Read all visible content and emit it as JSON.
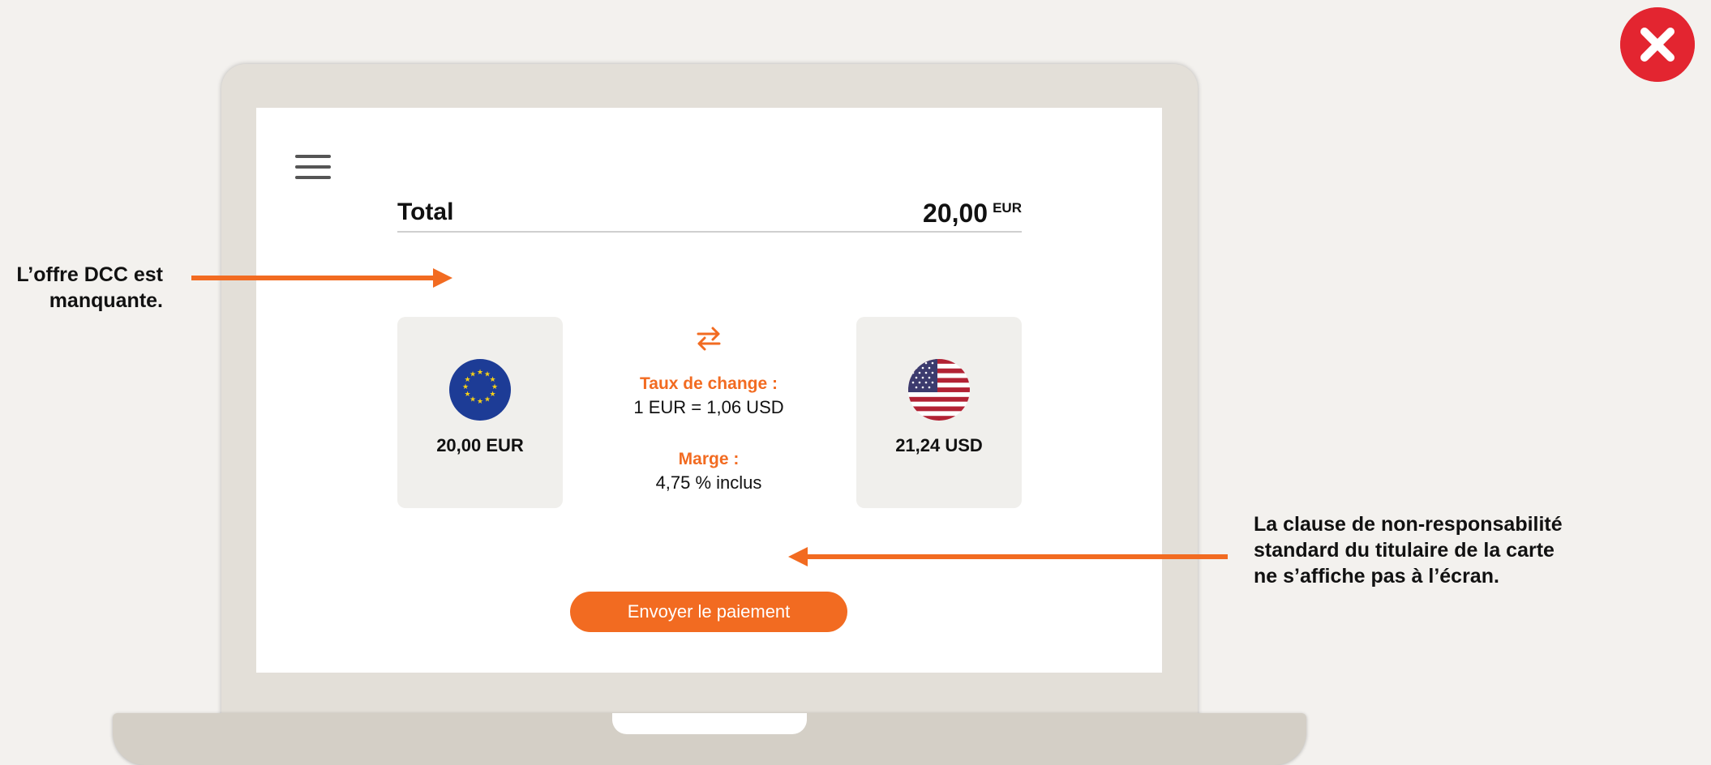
{
  "summary": {
    "total_label": "Total",
    "total_amount": "20,00",
    "total_currency": "EUR"
  },
  "conversion": {
    "source": {
      "amount": "20,00 EUR",
      "flag": "eu-flag-icon"
    },
    "target": {
      "amount": "21,24 USD",
      "flag": "us-flag-icon"
    },
    "swap_icon": "swap-arrows-icon",
    "rate_label": "Taux de change :",
    "rate_value": "1 EUR = 1,06 USD",
    "margin_label": "Marge :",
    "margin_value": "4,75 % inclus"
  },
  "actions": {
    "menu_icon": "hamburger-menu-icon",
    "pay_button_label": "Envoyer le paiement"
  },
  "annotations": {
    "dcc_missing_line1": "L’offre DCC est",
    "dcc_missing_line2": "manquante.",
    "disclaimer_missing_line1": "La clause de non-responsabilité",
    "disclaimer_missing_line2": "standard du titulaire de la carte",
    "disclaimer_missing_line3": "ne s’affiche pas à l’écran."
  },
  "status_icon": "error-x-icon",
  "colors": {
    "accent": "#f26b21",
    "error": "#e32530",
    "background": "#f3f1ee",
    "card_bg": "#f0efec"
  }
}
